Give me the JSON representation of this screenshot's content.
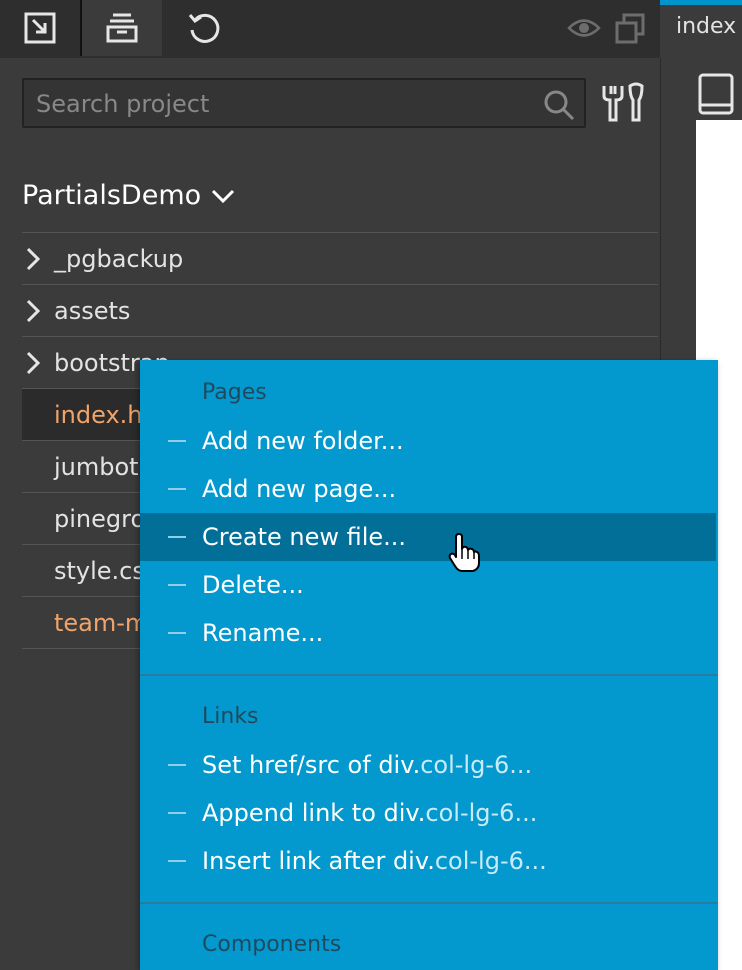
{
  "editor": {
    "tab_label": "index"
  },
  "search": {
    "placeholder": "Search project"
  },
  "project": {
    "name": "PartialsDemo"
  },
  "tree": [
    {
      "name": "_pgbackup",
      "type": "folder"
    },
    {
      "name": "assets",
      "type": "folder"
    },
    {
      "name": "bootstrap",
      "type": "folder"
    },
    {
      "name": "index.html",
      "type": "file",
      "selected": true,
      "highlight": "orange"
    },
    {
      "name": "jumbotron.html",
      "type": "file"
    },
    {
      "name": "pinegrow.json",
      "type": "file"
    },
    {
      "name": "style.css",
      "type": "file"
    },
    {
      "name": "team-member.html",
      "type": "file",
      "highlight": "orange"
    }
  ],
  "context_menu": {
    "pages_heading": "Pages",
    "pages_items": [
      "Add new folder...",
      "Add new page...",
      "Create new file...",
      "Delete...",
      "Rename..."
    ],
    "hovered_item": "Create new file...",
    "links_heading": "Links",
    "links_items": [
      {
        "prefix": "Set href/src of div.",
        "code": "col-lg-6..."
      },
      {
        "prefix": "Append link to div.",
        "code": "col-lg-6..."
      },
      {
        "prefix": "Insert link after div.",
        "code": "col-lg-6..."
      }
    ],
    "components_heading": "Components"
  },
  "colors": {
    "menu_bg": "#0399cf",
    "menu_hover": "#026f98",
    "accent": "#0094cc",
    "orange_file": "#f0a36a"
  },
  "icons": [
    "import-icon",
    "open-project-icon",
    "refresh-icon",
    "eye-icon",
    "duplicate-icon",
    "search-icon",
    "tools-icon",
    "chevron-down-icon",
    "chevron-right-icon",
    "tablet-icon",
    "hand-cursor-icon"
  ]
}
